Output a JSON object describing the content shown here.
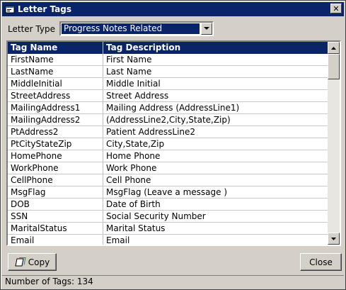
{
  "window": {
    "title": "Letter Tags",
    "close_glyph": "✕"
  },
  "filter": {
    "label": "Letter Type",
    "selected": "Progress Notes Related"
  },
  "table": {
    "headers": [
      "Tag Name",
      "Tag Description"
    ],
    "rows": [
      [
        "FirstName",
        "First Name"
      ],
      [
        "LastName",
        "Last Name"
      ],
      [
        "MiddleInitial",
        "Middle Initial"
      ],
      [
        "StreetAddress",
        "Street Address"
      ],
      [
        "MailingAddress1",
        "Mailing Address (AddressLine1)"
      ],
      [
        "MailingAddress2",
        "(AddressLine2,City,State,Zip)"
      ],
      [
        "PtAddress2",
        "Patient AddressLine2"
      ],
      [
        "PtCityStateZip",
        "City,State,Zip"
      ],
      [
        "HomePhone",
        "Home Phone"
      ],
      [
        "WorkPhone",
        "Work Phone"
      ],
      [
        "CellPhone",
        "Cell Phone"
      ],
      [
        "MsgFlag",
        "MsgFlag (Leave a message )"
      ],
      [
        "DOB",
        "Date of Birth"
      ],
      [
        "SSN",
        "Social Security Number"
      ],
      [
        "MaritalStatus",
        "Marital Status"
      ],
      [
        "Email",
        "Email"
      ]
    ]
  },
  "buttons": {
    "copy": "Copy",
    "close": "Close"
  },
  "status": {
    "text": "Number of Tags: 134"
  }
}
